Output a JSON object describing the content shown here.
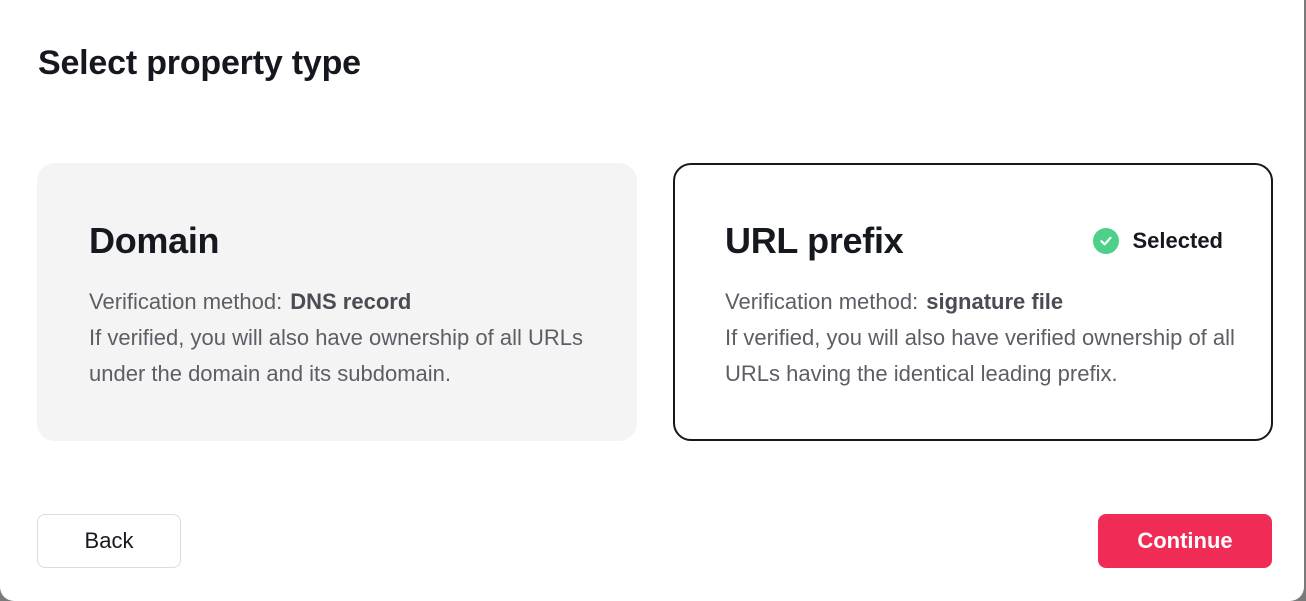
{
  "dialog": {
    "title": "Select property type"
  },
  "cards": {
    "domain": {
      "title": "Domain",
      "method_label": "Verification method:",
      "method_value": "DNS record",
      "description": "If verified, you will also have ownership of all URLs under the domain and its subdomain.",
      "selected": false
    },
    "url_prefix": {
      "title": "URL prefix",
      "method_label": "Verification method:",
      "method_value": "signature file",
      "description": "If verified, you will also have verified ownership of all URLs having the identical leading prefix.",
      "selected": true,
      "selected_label": "Selected"
    }
  },
  "footer": {
    "back_label": "Back",
    "continue_label": "Continue"
  },
  "colors": {
    "accent": "#f02c56",
    "selected_check": "#4fd08a",
    "selected_border": "#16181f",
    "unselected_card_bg": "#f4f4f4"
  },
  "icons": {
    "selected": "check-circle-icon"
  }
}
